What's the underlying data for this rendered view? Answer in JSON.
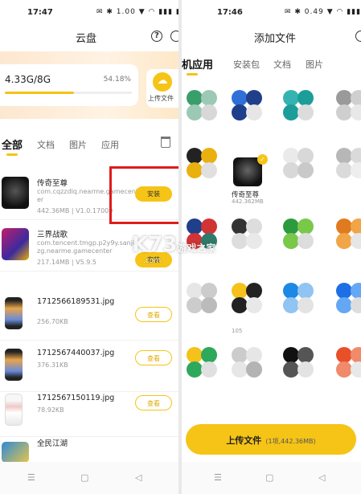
{
  "left": {
    "status": {
      "time": "17:47",
      "icons": "✉ ✱ 1.00 ▼ ◠ ▮▮▮ ▮▮",
      "battery": "77"
    },
    "title": "云盘",
    "help_icon": "question-icon",
    "storage": {
      "used": "4.33G/8G",
      "percent": "54.18%",
      "fraction": 0.5418
    },
    "upload_label": "上传文件",
    "tabs": [
      "全部",
      "文档",
      "图片",
      "应用"
    ],
    "files": [
      {
        "name": "传奇至尊",
        "line1": "com.cqzzdlq.nearme.gamecent",
        "line2": "er",
        "meta": "442.36MB | V1.0.17000",
        "action": "安装"
      },
      {
        "name": "三界战歌",
        "line1": "com.tencent.tmgp.p2y9y.sanjie",
        "line2": "zg.nearme.gamecenter",
        "meta": "217.14MB | V5.9.5",
        "action": "安装"
      },
      {
        "name": "1712566189531.jpg",
        "meta": "256.70KB",
        "action": "查看"
      },
      {
        "name": "1712567440037.jpg",
        "meta": "376.31KB",
        "action": "查看"
      },
      {
        "name": "1712567150119.jpg",
        "meta": "78.92KB",
        "action": "查看"
      },
      {
        "name": "全民江湖"
      }
    ]
  },
  "right": {
    "status": {
      "time": "17:46",
      "icons": "✉ ✱ 0.49 ▼ ◠ ▮▮▮ ▮▮",
      "battery": "77"
    },
    "title": "添加文件",
    "tabs": [
      "机应用",
      "安装包",
      "文档",
      "图片"
    ],
    "selected_app": {
      "name": "传奇至尊",
      "size": "442.362MB"
    },
    "small_label": "105",
    "upload_button": "上传文件",
    "upload_count": "(1项,442.36MB)"
  },
  "watermark": {
    "big": "K73",
    "mid": "游戏之家",
    "small": ".com"
  },
  "colors": {
    "accent": "#f5c416",
    "highlight": "#e01b1b"
  }
}
